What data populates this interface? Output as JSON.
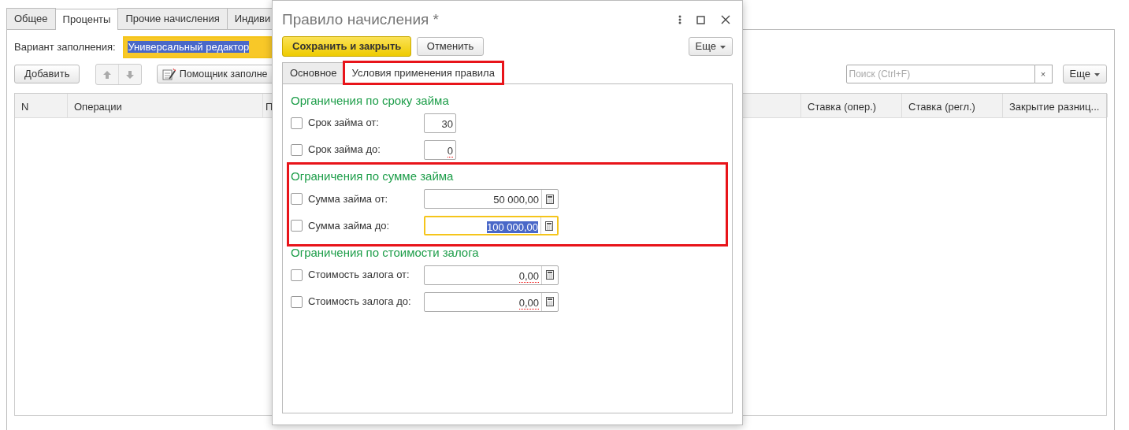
{
  "form": {
    "tabs": [
      {
        "label": "Общее",
        "selected": false
      },
      {
        "label": "Проценты",
        "selected": true
      },
      {
        "label": "Прочие начисления",
        "selected": false
      },
      {
        "label": "Индиви",
        "selected": false
      }
    ],
    "fill_variant": {
      "label": "Вариант заполнения:",
      "value": "Универсальный редактор"
    },
    "toolbar": {
      "add": "Добавить",
      "helper": "Помощник заполне",
      "search": {
        "placeholder": "Поиск (Ctrl+F)"
      },
      "clear": "×",
      "more": "Еще"
    },
    "table": {
      "columns": [
        "N",
        "Операции",
        "П",
        "Ставка (опер.)",
        "Ставка (регл.)",
        "Закрытие разниц..."
      ]
    }
  },
  "dialog": {
    "title": "Правило начисления *",
    "buttons": [
      {
        "label": "Сохранить и закрыть",
        "kind": "primary"
      },
      {
        "label": "Отменить",
        "kind": "default"
      }
    ],
    "more": "Еще",
    "tabs": [
      {
        "label": "Основное",
        "selected": false,
        "highlighted": false
      },
      {
        "label": "Условия применения правила",
        "selected": true,
        "highlighted": true
      }
    ],
    "sections": [
      {
        "title": "Органичения по сроку займа",
        "highlighted": false,
        "rows": [
          {
            "label": "Срок займа от:",
            "checked": false,
            "value": "30",
            "calculator": false,
            "marked": false,
            "focused": false
          },
          {
            "label": "Срок займа до:",
            "checked": false,
            "value": "0",
            "calculator": false,
            "marked": true,
            "focused": false
          }
        ]
      },
      {
        "title": "Ограничения по сумме займа",
        "highlighted": true,
        "rows": [
          {
            "label": "Сумма займа от:",
            "checked": false,
            "value": "50 000,00",
            "calculator": true,
            "marked": false,
            "focused": false
          },
          {
            "label": "Сумма займа до:",
            "checked": false,
            "value": "100 000,00",
            "calculator": true,
            "marked": false,
            "focused": true
          }
        ]
      },
      {
        "title": "Ограничения по стоимости залога",
        "highlighted": false,
        "rows": [
          {
            "label": "Стоимость залога от:",
            "checked": false,
            "value": "0,00",
            "calculator": true,
            "marked": true,
            "focused": false
          },
          {
            "label": "Стоимость залога до:",
            "checked": false,
            "value": "0,00",
            "calculator": true,
            "marked": true,
            "focused": false
          }
        ]
      }
    ]
  }
}
